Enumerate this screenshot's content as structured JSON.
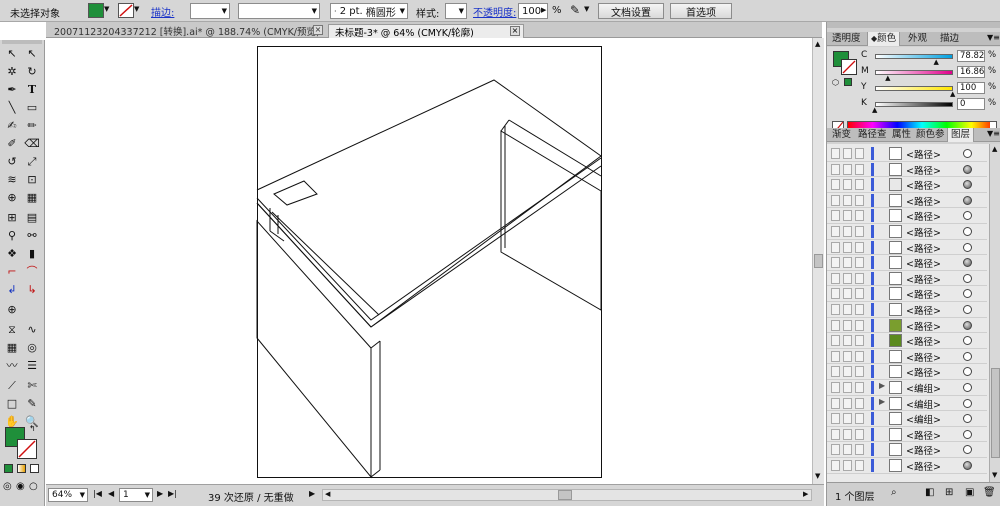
{
  "control_bar": {
    "selection_status": "未选择对象",
    "stroke_label": "描边:",
    "stroke_weight": "2 pt.",
    "brush_name": "椭圆形",
    "style_label": "样式:",
    "opacity_label": "不透明度:",
    "opacity_value": "100",
    "opacity_unit": "%",
    "doc_setup_button": "文档设置",
    "preferences_button": "首选项",
    "fill_color": "#1f8f3a",
    "stroke_color": "none"
  },
  "document_tabs": [
    {
      "label": "20071123204337212 [转换].ai* @ 188.74% (CMYK/预览)",
      "active": false
    },
    {
      "label": "未标题-3* @ 64% (CMYK/轮廓)",
      "active": true
    }
  ],
  "toolbox": {
    "fill_color": "#1f8f3a"
  },
  "status_bar": {
    "zoom": "64%",
    "page": "1",
    "history": "39 次还原 / 无重做"
  },
  "color_panel": {
    "tabs": [
      "透明度",
      "颜色",
      "外观",
      "描边"
    ],
    "active_tab": "颜色",
    "fill_color": "#1f8f3a",
    "channels": [
      {
        "label": "C",
        "value": "78.82",
        "fraction": 0.7882,
        "gradient_end": "#00a0e0"
      },
      {
        "label": "M",
        "value": "16.86",
        "fraction": 0.1686,
        "gradient_end": "#e0008c"
      },
      {
        "label": "Y",
        "value": "100",
        "fraction": 1.0,
        "gradient_end": "#ffe600"
      },
      {
        "label": "K",
        "value": "0",
        "fraction": 0.0,
        "gradient_end": "#000000"
      }
    ],
    "unit": "%"
  },
  "layers_panel": {
    "tabs": [
      "渐变",
      "路径查",
      "属性",
      "颜色参",
      "图层"
    ],
    "active_tab": "图层",
    "rows": [
      {
        "name": "<路径>",
        "filled": false,
        "thumb": "#ffffff",
        "expand": false
      },
      {
        "name": "<路径>",
        "filled": true,
        "thumb": "#ffffff",
        "expand": false
      },
      {
        "name": "<路径>",
        "filled": true,
        "thumb": "#e8e8e8",
        "expand": false
      },
      {
        "name": "<路径>",
        "filled": true,
        "thumb": "#ffffff",
        "expand": false
      },
      {
        "name": "<路径>",
        "filled": false,
        "thumb": "#ffffff",
        "expand": false
      },
      {
        "name": "<路径>",
        "filled": false,
        "thumb": "#ffffff",
        "expand": false
      },
      {
        "name": "<路径>",
        "filled": false,
        "thumb": "#ffffff",
        "expand": false
      },
      {
        "name": "<路径>",
        "filled": true,
        "thumb": "#ffffff",
        "expand": false
      },
      {
        "name": "<路径>",
        "filled": false,
        "thumb": "#ffffff",
        "expand": false
      },
      {
        "name": "<路径>",
        "filled": false,
        "thumb": "#ffffff",
        "expand": false
      },
      {
        "name": "<路径>",
        "filled": false,
        "thumb": "#ffffff",
        "expand": false
      },
      {
        "name": "<路径>",
        "filled": true,
        "thumb": "#7a9e2e",
        "expand": false
      },
      {
        "name": "<路径>",
        "filled": false,
        "thumb": "#5b8a1e",
        "expand": false
      },
      {
        "name": "<路径>",
        "filled": false,
        "thumb": "#ffffff",
        "expand": false
      },
      {
        "name": "<路径>",
        "filled": false,
        "thumb": "#ffffff",
        "expand": false
      },
      {
        "name": "<编组>",
        "filled": false,
        "thumb": "#ffffff",
        "expand": true
      },
      {
        "name": "<编组>",
        "filled": false,
        "thumb": "#ffffff",
        "expand": true
      },
      {
        "name": "<编组>",
        "filled": false,
        "thumb": "#ffffff",
        "expand": false
      },
      {
        "name": "<路径>",
        "filled": false,
        "thumb": "#ffffff",
        "expand": false
      },
      {
        "name": "<路径>",
        "filled": false,
        "thumb": "#ffffff",
        "expand": false
      },
      {
        "name": "<路径>",
        "filled": true,
        "thumb": "#ffffff",
        "expand": false
      }
    ],
    "footer_label": "1 个图层"
  }
}
